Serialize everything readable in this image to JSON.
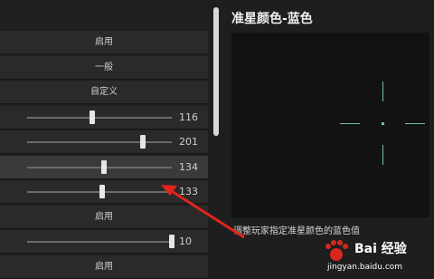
{
  "settings": [
    {
      "type": "option",
      "label": "启用"
    },
    {
      "type": "option",
      "label": "一般"
    },
    {
      "type": "option",
      "label": "自定义"
    },
    {
      "type": "slider",
      "value": "116",
      "fraction": 0.45
    },
    {
      "type": "slider",
      "value": "201",
      "fraction": 0.8
    },
    {
      "type": "slider",
      "value": "134",
      "fraction": 0.53,
      "highlight": true
    },
    {
      "type": "slider",
      "value": "133",
      "fraction": 0.52
    },
    {
      "type": "option",
      "label": "启用"
    },
    {
      "type": "slider",
      "value": "10",
      "fraction": 1.0
    },
    {
      "type": "option",
      "label": "启用"
    }
  ],
  "panel": {
    "title": "准星颜色-蓝色",
    "description": "调整玩家指定准星颜色的蓝色值",
    "crosshair_color": "#6fc1a9"
  },
  "watermark": {
    "text": "Bai 经验",
    "url": "jingyan.baidu.com"
  },
  "colors": {
    "background": "#1e1e1e",
    "row": "#2a2a2a",
    "row_highlight": "#3a3a3a",
    "arrow": "#e2231a"
  }
}
